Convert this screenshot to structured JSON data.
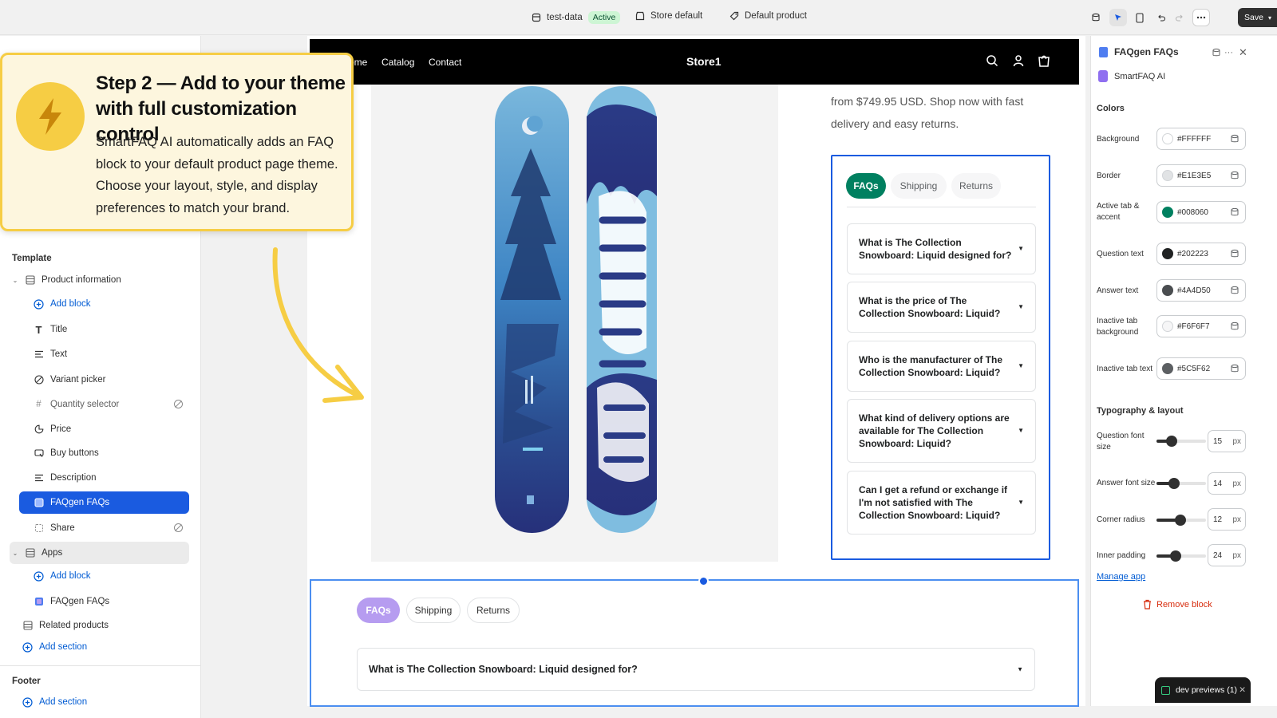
{
  "topbar": {
    "store": "test-data",
    "status": "Active",
    "theme": "Store default",
    "template": "Default product",
    "save": "Save"
  },
  "sidebar": {
    "template_heading": "Template",
    "items": [
      {
        "label": "Product information",
        "icon": "section-icon"
      },
      {
        "label": "Add block",
        "icon": "plus-circle-icon"
      },
      {
        "label": "Title",
        "icon": "text-title-icon"
      },
      {
        "label": "Text",
        "icon": "text-lines-icon"
      },
      {
        "label": "Variant picker",
        "icon": "variant-icon"
      },
      {
        "label": "Quantity selector",
        "icon": "hash-icon"
      },
      {
        "label": "Price",
        "icon": "price-tag-icon"
      },
      {
        "label": "Buy buttons",
        "icon": "cart-icon"
      },
      {
        "label": "Description",
        "icon": "text-lines-icon"
      },
      {
        "label": "FAQgen FAQs",
        "icon": "app-block-icon"
      },
      {
        "label": "Share",
        "icon": "share-icon"
      },
      {
        "label": "Apps",
        "icon": "section-icon"
      },
      {
        "label": "Add block",
        "icon": "plus-circle-icon"
      },
      {
        "label": "FAQgen FAQs",
        "icon": "app-block-icon"
      },
      {
        "label": "Related products",
        "icon": "section-icon"
      },
      {
        "label": "Add section",
        "icon": "plus-circle-icon"
      }
    ],
    "footer_heading": "Footer",
    "footer_add": "Add section"
  },
  "step": {
    "title": "Step 2 — Add to your theme with full customization control",
    "body": "SmartFAQ AI automatically adds an FAQ block to your default product page theme. Choose your layout, style, and display preferences to match your brand.",
    "icon": "lightning-icon"
  },
  "store": {
    "nav": [
      "ome",
      "Catalog",
      "Contact"
    ],
    "name": "Store1",
    "description": "from $749.95 USD. Shop now with fast delivery and easy returns."
  },
  "faq": {
    "tabs": [
      "FAQs",
      "Shipping",
      "Returns"
    ],
    "questions": [
      "What is The Collection Snowboard: Liquid designed for?",
      "What is the price of The Collection Snowboard: Liquid?",
      "Who is the manufacturer of The Collection Snowboard: Liquid?",
      "What kind of delivery options are available for The Collection Snowboard: Liquid?",
      "Can I get a refund or exchange if I'm not satisfied with The Collection Snowboard: Liquid?"
    ],
    "chevron": "▼"
  },
  "bottom_faq": {
    "tabs": [
      "FAQs",
      "Shipping",
      "Returns"
    ],
    "question": "What is The Collection Snowboard: Liquid designed for?"
  },
  "panel": {
    "title": "FAQgen FAQs",
    "subtitle": "SmartFAQ AI",
    "colors_heading": "Colors",
    "colors": [
      {
        "label": "Background",
        "hex": "#FFFFFF",
        "swatch": "#FFFFFF"
      },
      {
        "label": "Border",
        "hex": "#E1E3E5",
        "swatch": "#E1E3E5"
      },
      {
        "label": "Active tab & accent",
        "hex": "#008060",
        "swatch": "#008060"
      },
      {
        "label": "Question text",
        "hex": "#202223",
        "swatch": "#202223"
      },
      {
        "label": "Answer text",
        "hex": "#4A4D50",
        "swatch": "#4A4D50"
      },
      {
        "label": "Inactive tab background",
        "hex": "#F6F6F7",
        "swatch": "#F6F6F7"
      },
      {
        "label": "Inactive tab text",
        "hex": "#5C5F62",
        "swatch": "#5C5F62"
      }
    ],
    "typography_heading": "Typography & layout",
    "sliders": [
      {
        "label": "Question font size",
        "value": "15",
        "unit": "px",
        "fraction": 0.3
      },
      {
        "label": "Answer font size",
        "value": "14",
        "unit": "px",
        "fraction": 0.35
      },
      {
        "label": "Corner radius",
        "value": "12",
        "unit": "px",
        "fraction": 0.48
      },
      {
        "label": "Inner padding",
        "value": "24",
        "unit": "px",
        "fraction": 0.38
      }
    ],
    "manage_app": "Manage app",
    "remove_block": "Remove block"
  },
  "dev_previews": "dev previews (1)"
}
